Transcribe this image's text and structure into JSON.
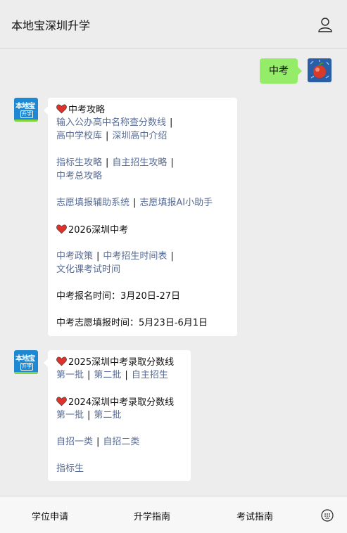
{
  "header": {
    "title": "本地宝深圳升学"
  },
  "user_message": {
    "text": "中考"
  },
  "bot_avatar": {
    "line1": "本地宝",
    "line2": "升学"
  },
  "card1": {
    "section1_title": "中考攻略",
    "row1": [
      "输入公办高中名称查分数线"
    ],
    "row2": [
      "高中学校库",
      "深圳高中介绍"
    ],
    "row3": [
      "指标生攻略",
      "自主招生攻略"
    ],
    "row4": [
      "中考总攻略"
    ],
    "row5": [
      "志愿填报辅助系统",
      "志愿填报AI小助手"
    ],
    "section2_title": "2026深圳中考",
    "row6": [
      "中考政策",
      "中考招生时间表"
    ],
    "row7": [
      "文化课考试时间"
    ],
    "info1": "中考报名时间：3月20日-27日",
    "info2": "中考志愿填报时间：5月23日-6月1日"
  },
  "card2": {
    "section1_title": "2025深圳中考录取分数线",
    "row1": [
      "第一批",
      "第二批",
      "自主招生"
    ],
    "section2_title": "2024深圳中考录取分数线",
    "row2": [
      "第一批",
      "第二批"
    ],
    "row3": [
      "自招一类",
      "自招二类"
    ],
    "row4": [
      "指标生"
    ]
  },
  "separator": "|",
  "footer": {
    "tabs": [
      "学位申请",
      "升学指南",
      "考试指南"
    ]
  },
  "colors": {
    "link": "#576b95",
    "bubble_me": "#95ec69",
    "heart": "#e0322c"
  }
}
